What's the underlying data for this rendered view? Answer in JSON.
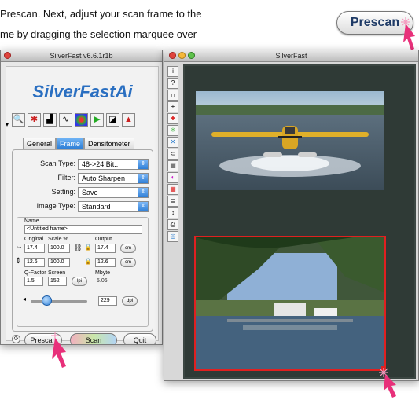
{
  "instruction": {
    "line1": "Prescan. Next, adjust your scan frame to the",
    "line2": "me by dragging the selection marquee over"
  },
  "prescan_callout": {
    "label": "Prescan"
  },
  "control_window": {
    "title": "SilverFast v6.6.1r1b",
    "logo": "SilverFastAi",
    "tabs": [
      "General",
      "Frame",
      "Densitometer"
    ],
    "active_tab": "Frame",
    "settings": [
      {
        "label": "Scan Type:",
        "value": "48->24 Bit..."
      },
      {
        "label": "Filter:",
        "value": "Auto Sharpen"
      },
      {
        "label": "Setting:",
        "value": "Save"
      },
      {
        "label": "Image Type:",
        "value": "Standard"
      }
    ],
    "frame": {
      "name_label": "Name",
      "name_value": "<Untitled frame>",
      "col_original": "Original",
      "col_scale": "Scale %",
      "col_output": "Output",
      "width_original": "17.4",
      "width_scale": "100.0",
      "width_output": "17.4",
      "height_original": "12.6",
      "height_scale": "100.0",
      "height_output": "12.6",
      "unit": "cm",
      "qfactor_label": "Q-Factor",
      "screen_label": "Screen",
      "mbyte_label": "Mbyte",
      "qfactor_value": "1.5",
      "screen_value": "152",
      "lpi_label": "lpi",
      "mbyte_value": "5.06",
      "resolution_value": "229",
      "dpi_label": "dpi"
    },
    "buttons": {
      "prescan": "Prescan",
      "scan": "Scan",
      "quit": "Quit"
    }
  },
  "preview_window": {
    "title": "SilverFast",
    "tool_icons": [
      "info-tool",
      "help-tool",
      "hand-tool",
      "zoom-tool",
      "midtone-tool",
      "color-cast-tool",
      "selective-color-tool",
      "gradation-tool",
      "histogram-tool",
      "expert-tool",
      "frame-tool",
      "loupe-tool",
      "print-tool",
      "magnifier-tool"
    ]
  },
  "colors": {
    "logo_blue": "#2a6fc1",
    "tab_active": "#2f7fd6",
    "selection_red": "#e02020",
    "cursor_pink": "#e8307a",
    "preview_bg": "#2f3a36"
  }
}
